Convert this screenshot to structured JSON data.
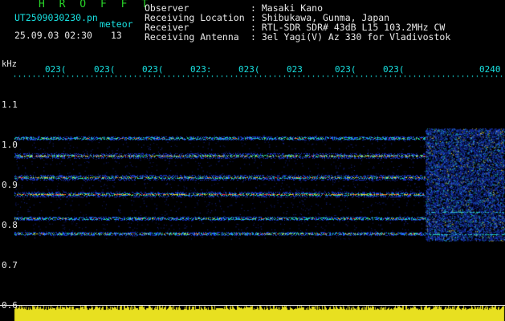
{
  "header": {
    "title": "H R O F F T",
    "filename": "UT2509030230.pn",
    "mode": "meteor",
    "date_time": "25.09.03 02:30",
    "count": "13",
    "labels": "Observer\nReceiving Location\nReceiver\nReceiving Antenna",
    "values": ": Masaki Kano\n: Shibukawa, Gunma, Japan\n: RTL-SDR SDR# 43dB L15 103.2MHz CW\n: 3el Yagi(V) Az 330 for Vladivostok"
  },
  "axis": {
    "unit": "kHz",
    "time_ticks": [
      "023(",
      "023(",
      "023(",
      "023:",
      "023(",
      "023",
      "023(",
      "023(",
      "0240"
    ],
    "freq_ticks": [
      "1.1",
      "1.0",
      "0.9",
      "0.8",
      "0.7",
      "0.6"
    ]
  },
  "colors": {
    "background": "#000000",
    "title": "#28d228",
    "header_text": "#e8e8e8",
    "ticks": "#18e0e0",
    "noise_bar": "#e8e020"
  }
}
